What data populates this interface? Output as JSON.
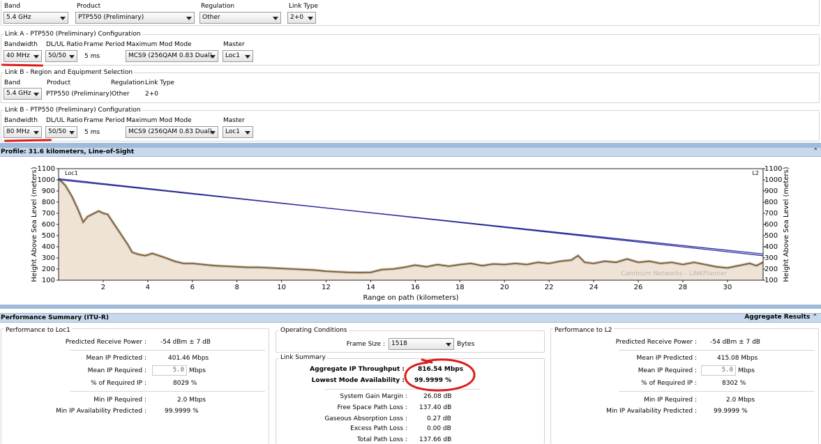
{
  "top": {
    "band": {
      "label": "Band",
      "value": "5.4 GHz"
    },
    "product": {
      "label": "Product",
      "value": "PTP550 (Preliminary)"
    },
    "regulation": {
      "label": "Regulation",
      "value": "Other"
    },
    "link_type": {
      "label": "Link Type",
      "value": "2+0"
    }
  },
  "link_a_config": {
    "title": "Link A - PTP550 (Preliminary) Configuration",
    "bandwidth": {
      "label": "Bandwidth",
      "value": "40 MHz"
    },
    "dlul": {
      "label": "DL/UL Ratio",
      "value": "50/50"
    },
    "frame": {
      "label": "Frame Period",
      "value": "5 ms"
    },
    "maxmod": {
      "label": "Maximum Mod Mode",
      "value": "MCS9 (256QAM 0.83 Dual)"
    },
    "master": {
      "label": "Master",
      "value": "Loc1"
    }
  },
  "link_b_region": {
    "title": "Link B - Region and Equipment Selection",
    "band": {
      "label": "Band",
      "value": "5.4 GHz"
    },
    "product": {
      "label": "Product",
      "value": "PTP550 (Preliminary)"
    },
    "regulation": {
      "label": "Regulation",
      "value": "Other"
    },
    "link_type": {
      "label": "Link Type",
      "value": "2+0"
    }
  },
  "link_b_config": {
    "title": "Link B - PTP550 (Preliminary) Configuration",
    "bandwidth": {
      "label": "Bandwidth",
      "value": "80 MHz"
    },
    "dlul": {
      "label": "DL/UL Ratio",
      "value": "50/50"
    },
    "frame": {
      "label": "Frame Period",
      "value": "5 ms"
    },
    "maxmod": {
      "label": "Maximum Mod Mode",
      "value": "MCS9 (256QAM 0.83 Dual)"
    },
    "master": {
      "label": "Master",
      "value": "Loc1"
    }
  },
  "profile": {
    "title": "Profile: 31.6 kilometers, Line-of-Sight",
    "site_left": "Loc1",
    "site_right": "L2",
    "watermark": "Cambium Networks - LINKPlanner",
    "collapse_icon": "double-chevron-up-icon"
  },
  "chart_data": {
    "type": "area",
    "xlabel": "Range on path (kilometers)",
    "ylabel": "Height Above Sea Level (meters)",
    "xlim": [
      0,
      31.6
    ],
    "ylim": [
      100,
      1100
    ],
    "xticks": [
      2,
      4,
      6,
      8,
      10,
      12,
      14,
      16,
      18,
      20,
      22,
      24,
      26,
      28,
      30
    ],
    "yticks": [
      100,
      200,
      300,
      400,
      500,
      600,
      700,
      800,
      900,
      1000,
      1100
    ],
    "terrain": {
      "x": [
        0,
        0.3,
        0.6,
        0.9,
        1.1,
        1.3,
        1.6,
        1.8,
        2.0,
        2.2,
        2.5,
        2.7,
        2.9,
        3.1,
        3.3,
        3.6,
        3.9,
        4.2,
        4.5,
        4.8,
        5.2,
        5.6,
        6.0,
        6.5,
        7.0,
        7.5,
        8.0,
        8.5,
        9.0,
        9.5,
        10.0,
        10.5,
        11.0,
        11.5,
        12.0,
        12.5,
        13.0,
        13.5,
        14.0,
        14.5,
        15.0,
        15.5,
        16.0,
        16.5,
        17.0,
        17.5,
        18.0,
        18.5,
        19.0,
        19.5,
        20.0,
        20.5,
        21.0,
        21.5,
        22.0,
        22.5,
        23.0,
        23.3,
        23.6,
        24.0,
        24.5,
        25.0,
        25.5,
        26.0,
        26.5,
        27.0,
        27.5,
        28.0,
        28.5,
        29.0,
        29.5,
        30.0,
        30.5,
        31.0,
        31.3,
        31.6
      ],
      "y": [
        1010,
        950,
        850,
        720,
        620,
        670,
        700,
        720,
        700,
        690,
        600,
        540,
        480,
        420,
        350,
        330,
        320,
        340,
        320,
        300,
        270,
        250,
        250,
        240,
        230,
        225,
        220,
        215,
        215,
        210,
        205,
        200,
        195,
        190,
        180,
        175,
        170,
        168,
        170,
        195,
        200,
        215,
        235,
        220,
        240,
        225,
        240,
        250,
        230,
        245,
        240,
        250,
        240,
        260,
        250,
        270,
        280,
        320,
        260,
        250,
        270,
        260,
        290,
        260,
        270,
        250,
        260,
        240,
        260,
        240,
        220,
        210,
        230,
        250,
        230,
        260
      ]
    },
    "series": [
      {
        "x": [
          0,
          31.6
        ],
        "y": [
          1010,
          320
        ]
      },
      {
        "x": [
          0,
          31.6
        ],
        "y": [
          1000,
          335
        ]
      }
    ],
    "grid": false
  },
  "perf": {
    "title": "Performance Summary (ITU-R)",
    "aggregate_label": "Aggregate Results",
    "loc1": {
      "title": "Performance to Loc1",
      "rx_power_label": "Predicted Receive Power :",
      "rx_power": "-54 dBm ± 7 dB",
      "mean_pred_label": "Mean IP Predicted :",
      "mean_pred": "401.46 Mbps",
      "mean_req_label": "Mean IP Required :",
      "mean_req": "5.0",
      "mean_req_unit": "Mbps",
      "pct_label": "% of Required IP :",
      "pct": "8029 %",
      "min_req_label": "Min IP Required :",
      "min_req": "2.0 Mbps",
      "min_avail_label": "Min IP Availability Predicted :",
      "min_avail": "99.9999 %"
    },
    "l2": {
      "title": "Performance to L2",
      "rx_power_label": "Predicted Receive Power :",
      "rx_power": "-54 dBm ± 7 dB",
      "mean_pred_label": "Mean IP Predicted :",
      "mean_pred": "415.08 Mbps",
      "mean_req_label": "Mean IP Required :",
      "mean_req": "5.0",
      "mean_req_unit": "Mbps",
      "pct_label": "% of Required IP :",
      "pct": "8302 %",
      "min_req_label": "Min IP Required :",
      "min_req": "2.0 Mbps",
      "min_avail_label": "Min IP Availability Predicted :",
      "min_avail": "99.9999 %"
    },
    "conditions": {
      "title": "Operating Conditions",
      "frame_size_label": "Frame Size :",
      "frame_size": "1518",
      "frame_size_unit": "Bytes"
    },
    "link_summary": {
      "title": "Link Summary",
      "agg_label": "Aggregate IP Throughput :",
      "agg": "816.54 Mbps",
      "lowest_label": "Lowest Mode Availability :",
      "lowest": "99.9999 %",
      "sgm_label": "System Gain Margin :",
      "sgm": "26.08 dB",
      "fspl_label": "Free Space Path Loss :",
      "fspl": "137.40 dB",
      "gal_label": "Gaseous Absorption Loss :",
      "gal": "0.27 dB",
      "epl_label": "Excess Path Loss :",
      "epl": "0.00 dB",
      "tpl_label": "Total Path Loss :",
      "tpl": "137.66 dB"
    }
  },
  "colors": {
    "annotation": "#dd1b1b",
    "terrain_line": "#7a5a2a",
    "terrain_fill": "#efe3d6",
    "los_line": "#2a2a9a",
    "header_bar": "#c8d9ee"
  }
}
